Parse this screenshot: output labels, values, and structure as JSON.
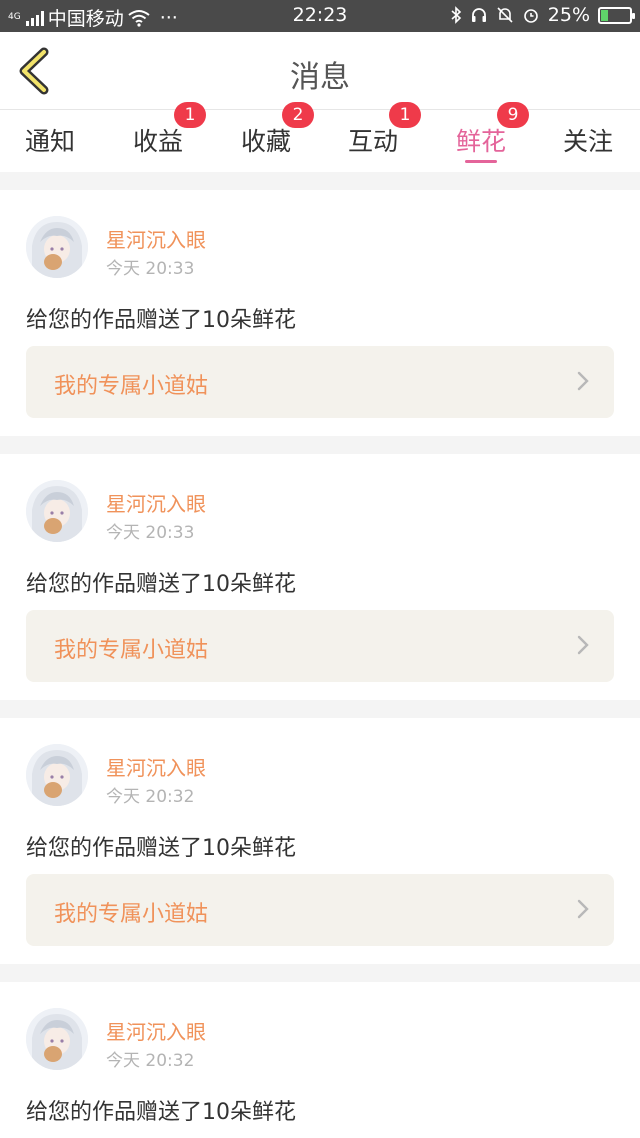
{
  "status_bar": {
    "network_tag": "4G",
    "carrier": "中国移动",
    "more": "···",
    "time": "22:23",
    "battery": "25%",
    "battery_level": 0.25,
    "icons": [
      "signal-icon",
      "wifi-icon",
      "bluetooth-icon",
      "headset-icon",
      "mute-bell-icon",
      "alarm-icon",
      "battery-charging-icon"
    ]
  },
  "header": {
    "title": "消息",
    "back_icon": "chevron-left-icon"
  },
  "tabs": [
    {
      "label": "通知",
      "badge": ""
    },
    {
      "label": "收益",
      "badge": "1"
    },
    {
      "label": "收藏",
      "badge": "2"
    },
    {
      "label": "互动",
      "badge": "1"
    },
    {
      "label": "鲜花",
      "badge": "9",
      "active": true
    },
    {
      "label": "关注",
      "badge": ""
    }
  ],
  "colors": {
    "accent_pink": "#e4649a",
    "badge_red": "#ef3a4a",
    "name_orange": "#f0925a",
    "status_bar_bg": "#4a4a4a"
  },
  "messages": [
    {
      "user": "星河沉入眼",
      "time": "今天 20:33",
      "text": "给您的作品赠送了10朵鲜花",
      "work": "我的专属小道姑"
    },
    {
      "user": "星河沉入眼",
      "time": "今天 20:33",
      "text": "给您的作品赠送了10朵鲜花",
      "work": "我的专属小道姑"
    },
    {
      "user": "星河沉入眼",
      "time": "今天 20:32",
      "text": "给您的作品赠送了10朵鲜花",
      "work": "我的专属小道姑"
    },
    {
      "user": "星河沉入眼",
      "time": "今天 20:32",
      "text": "给您的作品赠送了10朵鲜花",
      "work": ""
    }
  ]
}
